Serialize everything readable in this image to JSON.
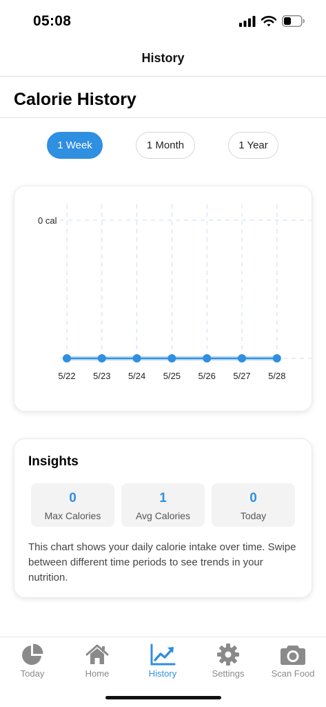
{
  "status_bar": {
    "time": "05:08"
  },
  "nav": {
    "title": "History"
  },
  "page": {
    "title": "Calorie History"
  },
  "periods": [
    {
      "label": "1 Week",
      "active": true
    },
    {
      "label": "1 Month",
      "active": false
    },
    {
      "label": "1 Year",
      "active": false
    }
  ],
  "chart_data": {
    "type": "line",
    "x": [
      "5/22",
      "5/23",
      "5/24",
      "5/25",
      "5/26",
      "5/27",
      "5/28"
    ],
    "values": [
      0,
      0,
      0,
      0,
      0,
      0,
      0
    ],
    "y_tick_labels": [
      "0 cal"
    ],
    "grid": true,
    "color": "#2f8fe0"
  },
  "insights": {
    "title": "Insights",
    "stats": [
      {
        "value": "0",
        "label": "Max Calories"
      },
      {
        "value": "1",
        "label": "Avg Calories"
      },
      {
        "value": "0",
        "label": "Today"
      }
    ],
    "description": "This chart shows your daily calorie intake over time. Swipe between different time periods to see trends in your nutrition."
  },
  "tabs": [
    {
      "label": "Today",
      "icon": "pie-chart-icon",
      "active": false
    },
    {
      "label": "Home",
      "icon": "home-icon",
      "active": false
    },
    {
      "label": "History",
      "icon": "trend-chart-icon",
      "active": true
    },
    {
      "label": "Settings",
      "icon": "gear-icon",
      "active": false
    },
    {
      "label": "Scan Food",
      "icon": "camera-icon",
      "active": false
    }
  ],
  "colors": {
    "accent": "#2f8fe0",
    "inactive": "#8a8a8a"
  }
}
